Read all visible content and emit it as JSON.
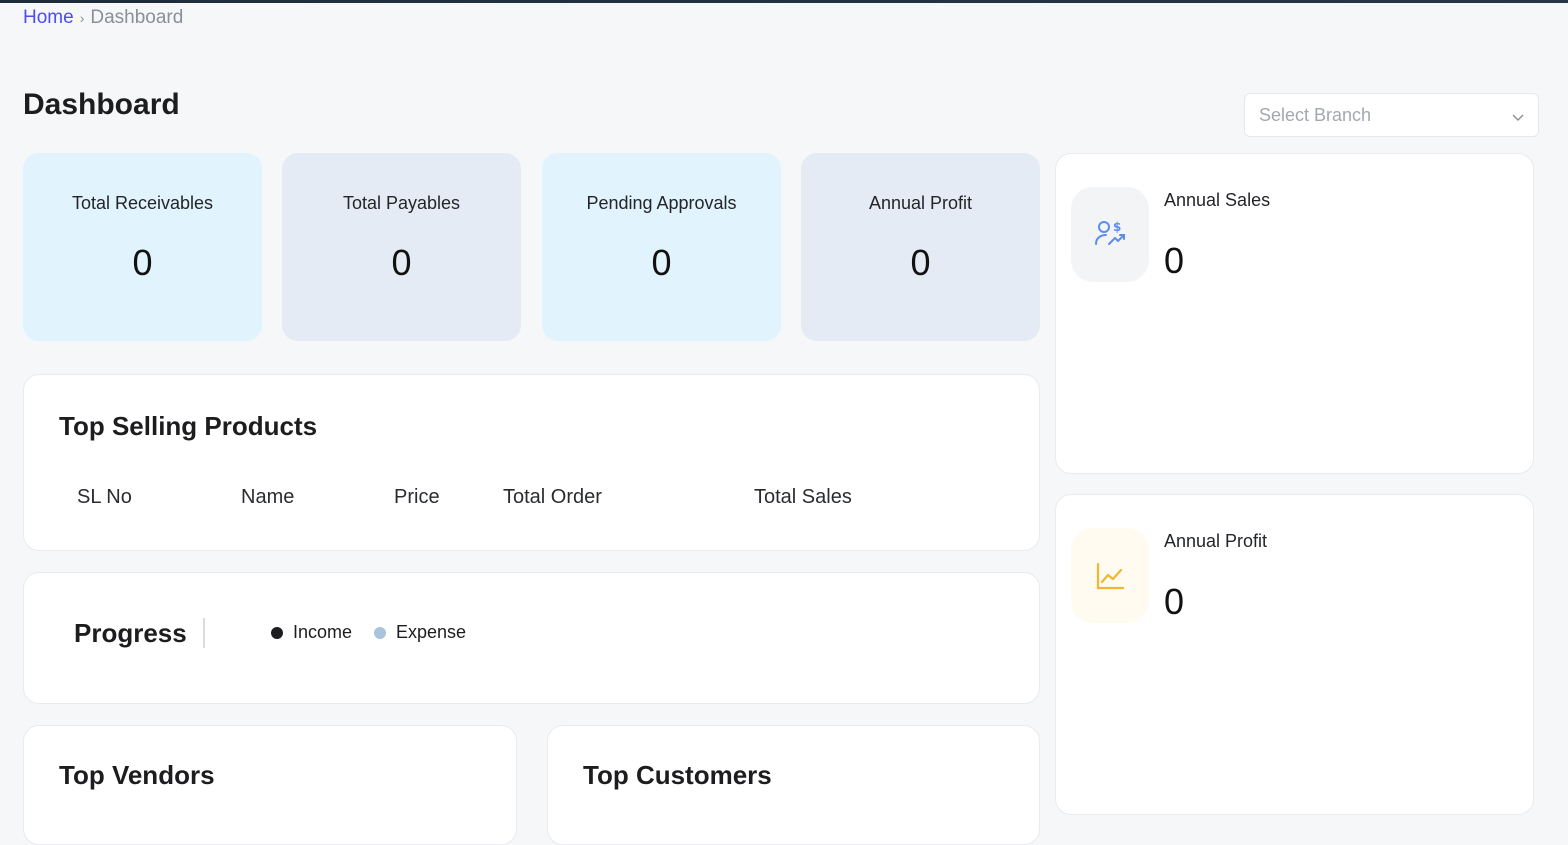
{
  "breadcrumb": {
    "home": "Home",
    "separator": "›",
    "current": "Dashboard"
  },
  "page": {
    "title": "Dashboard"
  },
  "branch_select": {
    "placeholder": "Select Branch"
  },
  "stats": [
    {
      "label": "Total Receivables",
      "value": "0"
    },
    {
      "label": "Total Payables",
      "value": "0"
    },
    {
      "label": "Pending Approvals",
      "value": "0"
    },
    {
      "label": "Annual Profit",
      "value": "0"
    }
  ],
  "top_selling": {
    "title": "Top Selling Products",
    "columns": [
      "SL No",
      "Name",
      "Price",
      "Total Order",
      "Total Sales"
    ]
  },
  "progress": {
    "title": "Progress",
    "legend": [
      {
        "label": "Income",
        "color": "#1d1d1f"
      },
      {
        "label": "Expense",
        "color": "#a9c3dc"
      }
    ]
  },
  "top_vendors": {
    "title": "Top Vendors"
  },
  "top_customers": {
    "title": "Top Customers"
  },
  "side_cards": [
    {
      "label": "Annual Sales",
      "value": "0",
      "icon": "user-dollar-icon",
      "icon_color": "#5b8def",
      "icon_bg": "#f3f4f6"
    },
    {
      "label": "Annual Profit",
      "value": "0",
      "icon": "trend-chart-icon",
      "icon_color": "#f2b632",
      "icon_bg": "#fffbf0"
    }
  ]
}
